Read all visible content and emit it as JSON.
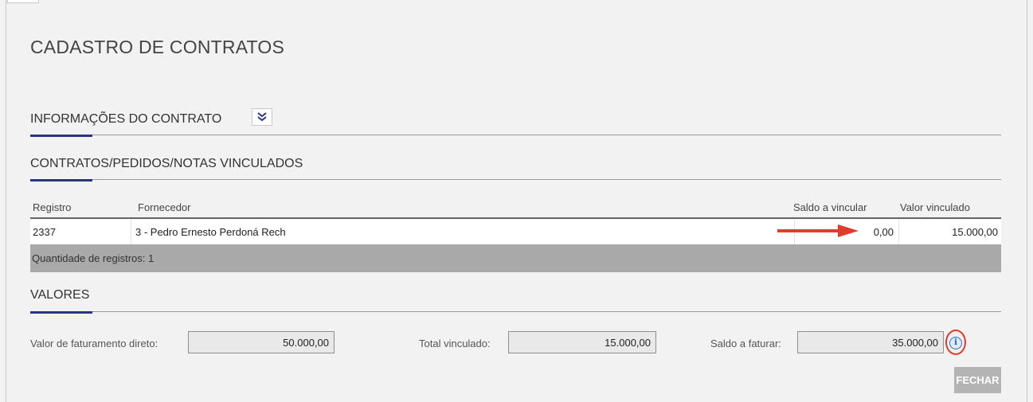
{
  "page": {
    "title": "CADASTRO DE CONTRATOS"
  },
  "sections": {
    "info": {
      "title": "INFORMAÇÕES DO CONTRATO",
      "toggle_icon": "double-chevron-down-icon"
    },
    "linked": {
      "title": "CONTRATOS/PEDIDOS/NOTAS VINCULADOS"
    },
    "values": {
      "title": "VALORES"
    }
  },
  "grid": {
    "columns": [
      "Registro",
      "Fornecedor",
      "Saldo a vincular",
      "Valor vinculado"
    ],
    "rows": [
      {
        "registro": "2337",
        "fornecedor": "3 - Pedro Ernesto Perdoná Rech",
        "saldo": "0,00",
        "valor": "15.000,00"
      }
    ],
    "footer": "Quantidade de registros: 1"
  },
  "values": {
    "faturamento": {
      "label": "Valor de faturamento direto:",
      "value": "50.000,00"
    },
    "vinculado": {
      "label": "Total vinculado:",
      "value": "15.000,00"
    },
    "saldo": {
      "label": "Saldo a faturar:",
      "value": "35.000,00"
    }
  },
  "info_icon": "info-icon",
  "buttons": {
    "close": "FECHAR"
  },
  "colors": {
    "accent": "#2a3486",
    "annotation": "#e23b2e",
    "footer_bg": "#a9a9a9",
    "button_bg": "#b4b4b4"
  }
}
